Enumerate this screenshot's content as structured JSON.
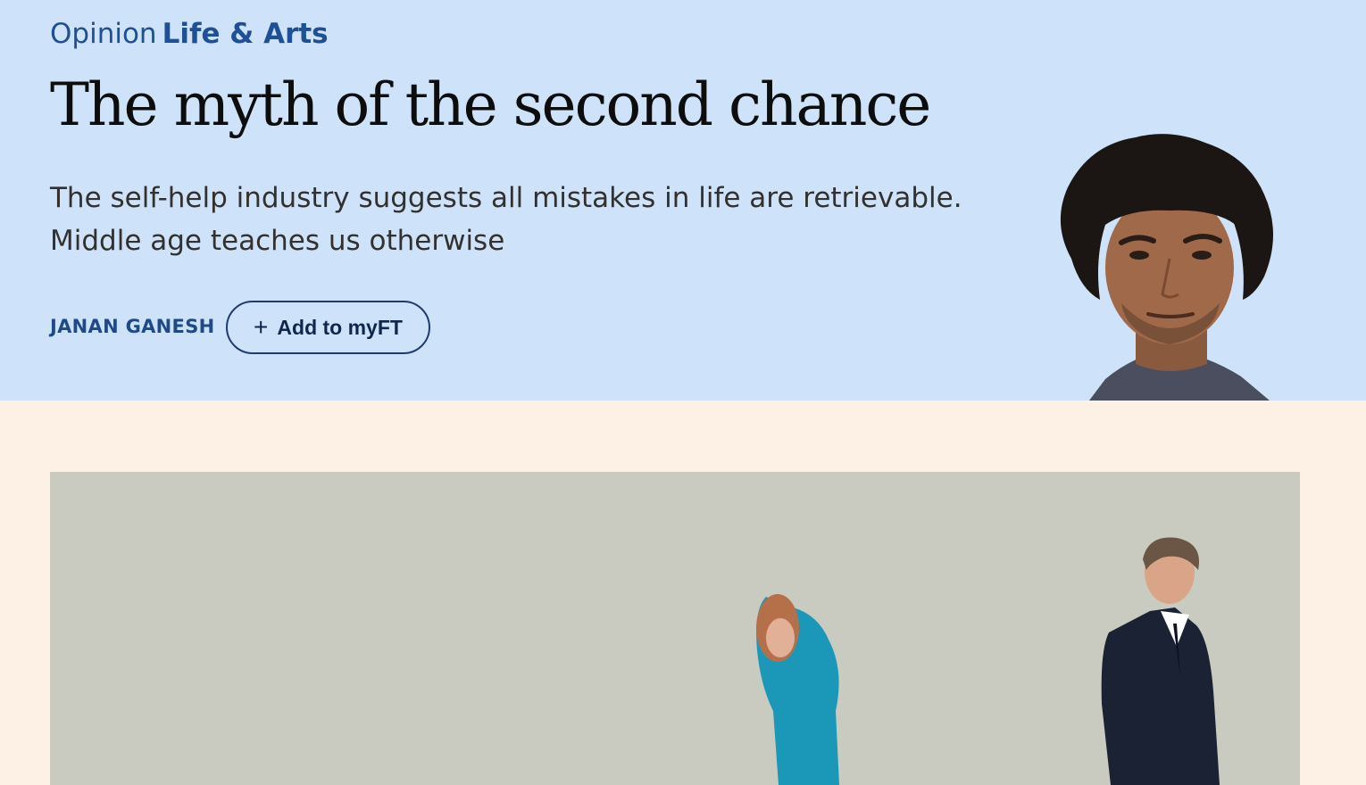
{
  "article": {
    "genre": "Opinion",
    "topic": "Life & Arts",
    "headline": "The myth of the second chance",
    "standfirst": "The self-help industry suggests all mistakes in life are retrievable. Middle age teaches us otherwise",
    "author": "JANAN GANESH",
    "myft_button": {
      "icon": "plus-icon",
      "label": "Add to myFT"
    }
  },
  "colors": {
    "header_background": "#cee3fa",
    "page_background": "#fdf1e5",
    "link_blue": "#1e5096",
    "headline_text": "#0d0d0d",
    "button_border": "#1e3d6e"
  },
  "images": {
    "author_headshot": "author-headshot-photo",
    "hero": "hero-photo-woman-in-teal-dress-and-man-in-dark-suit"
  }
}
